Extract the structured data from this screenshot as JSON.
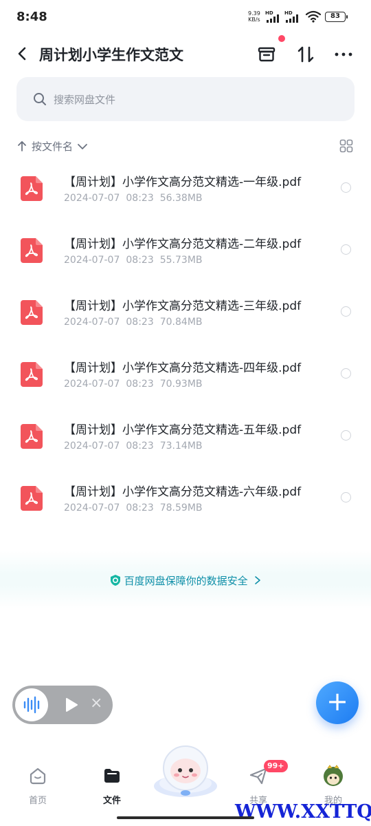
{
  "status_bar": {
    "time": "8:48",
    "net_speed_value": "9.39",
    "net_speed_unit": "KB/s",
    "signal1_label": "HD",
    "signal2_label": "HD",
    "battery": "83"
  },
  "header": {
    "title": "周计划小学生作文范文",
    "icons": [
      "back-icon",
      "archive-icon",
      "sort-icon",
      "more-icon"
    ]
  },
  "search": {
    "placeholder": "搜索网盘文件"
  },
  "sort": {
    "label": "按文件名"
  },
  "files": [
    {
      "name": "【周计划】小学作文高分范文精选-一年级.pdf",
      "date": "2024-07-07",
      "time": "08:23",
      "size": "56.38MB"
    },
    {
      "name": "【周计划】小学作文高分范文精选-二年级.pdf",
      "date": "2024-07-07",
      "time": "08:23",
      "size": "55.73MB"
    },
    {
      "name": "【周计划】小学作文高分范文精选-三年级.pdf",
      "date": "2024-07-07",
      "time": "08:23",
      "size": "70.84MB"
    },
    {
      "name": "【周计划】小学作文高分范文精选-四年级.pdf",
      "date": "2024-07-07",
      "time": "08:23",
      "size": "70.93MB"
    },
    {
      "name": "【周计划】小学作文高分范文精选-五年级.pdf",
      "date": "2024-07-07",
      "time": "08:23",
      "size": "73.14MB"
    },
    {
      "name": "【周计划】小学作文高分范文精选-六年级.pdf",
      "date": "2024-07-07",
      "time": "08:23",
      "size": "78.59MB"
    }
  ],
  "security_note": "百度网盘保障你的数据安全",
  "player": {
    "close_glyph": "×"
  },
  "fab": {
    "glyph": "+"
  },
  "nav": {
    "items": [
      {
        "label": "首页"
      },
      {
        "label": "文件"
      },
      {
        "label": ""
      },
      {
        "label": "共享"
      },
      {
        "label": "我的"
      }
    ],
    "share_badge": "99+"
  },
  "watermark": "WWW.XXTTQ.COM",
  "colors": {
    "accent": "#1d7cf2",
    "pdf_red": "#f2545b",
    "security_text": "#0e8fa8",
    "badge_red": "#ff4866"
  }
}
